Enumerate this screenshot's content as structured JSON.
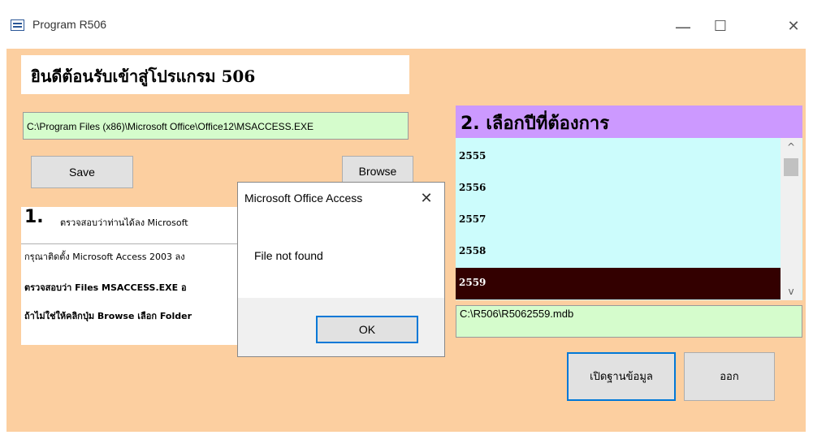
{
  "window": {
    "title": "Program R506",
    "minimize_glyph": "—",
    "maximize_glyph": "☐",
    "close_glyph": "✕",
    "app_icon": "form-icon"
  },
  "main": {
    "welcome": "ยินดีต้อนรับเข้าสู่โปรแกรม 506",
    "access_path": "C:\\Program Files (x86)\\Microsoft Office\\Office12\\MSACCESS.EXE",
    "save_label": "Save",
    "browse_label": "Browse",
    "step1_number": "1.",
    "step1_line1": "ตรวจสอบว่าท่านได้ลง Microsoft",
    "step1_line2": "กรุณาติดตั้ง Microsoft Access 2003 ลง",
    "step1_line3": "ตรวจสอบว่า Files  MSACCESS.EXE อ",
    "step1_line4": "ถ้าไม่ใช่ให้คลิกปุ่ม  Browse เลือก Folder"
  },
  "years": {
    "header": "2. เลือกปีที่ต้องการ",
    "items": [
      "2555",
      "2556",
      "2557",
      "2558",
      "2559"
    ],
    "selected": "2559",
    "db_path": "C:\\R506\\R5062559.mdb",
    "scroll_up_glyph": "^",
    "scroll_down_glyph": "v"
  },
  "actions": {
    "open_db_label": "เปิดฐานข้อมูล",
    "exit_label": "ออก"
  },
  "dialog": {
    "title": "Microsoft Office Access",
    "close_glyph": "✕",
    "message": "File not found",
    "ok_label": "OK"
  },
  "colors": {
    "form_background": "#fccfa0",
    "path_field": "#d5fccc",
    "list_background": "#ccfcfc",
    "list_header": "#cc99ff",
    "selected_row": "#330000",
    "focus_border": "#0078d7"
  }
}
